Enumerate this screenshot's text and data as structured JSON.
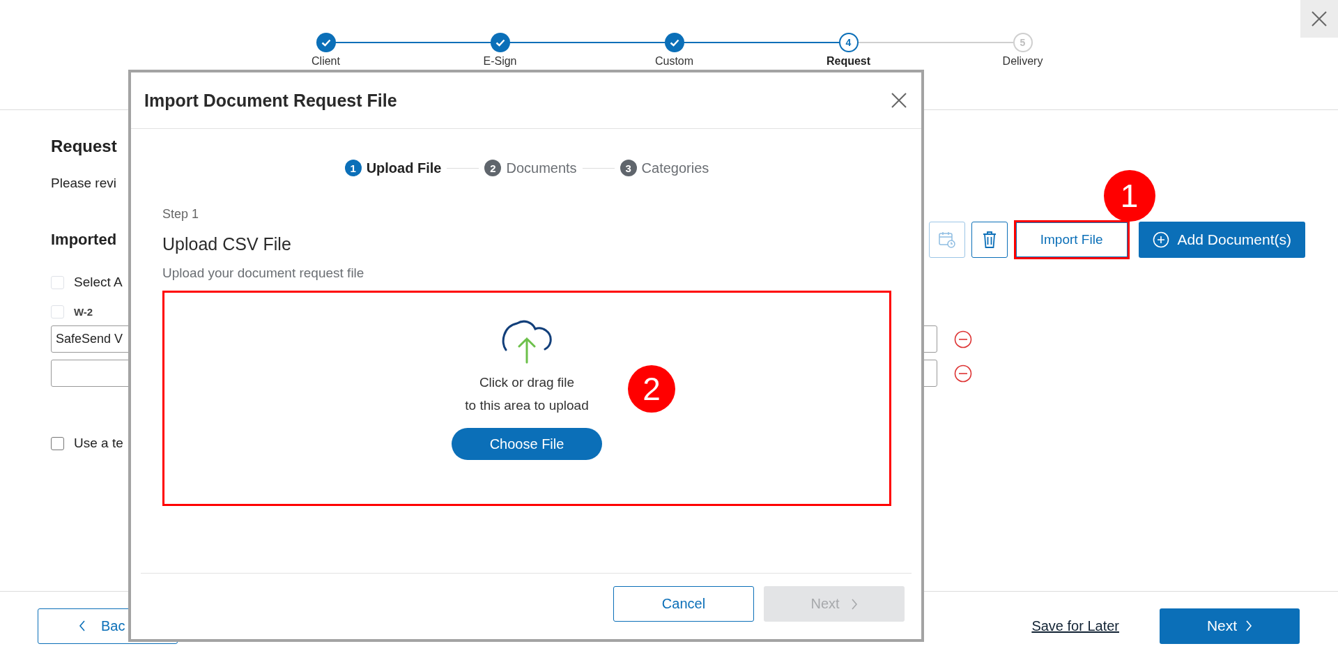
{
  "wizard_steps": [
    {
      "label": "Client",
      "completed": true,
      "current": false
    },
    {
      "label": "E-Sign",
      "completed": true,
      "current": false
    },
    {
      "label": "Custom",
      "completed": true,
      "current": false
    },
    {
      "label": "Request",
      "number": "4",
      "completed": false,
      "current": true
    },
    {
      "label": "Delivery",
      "number": "5",
      "completed": false,
      "current": false
    }
  ],
  "page": {
    "title": "Request",
    "description": "Please revi",
    "section_title": "Imported",
    "select_all": {
      "label": "Select A",
      "checked": false
    },
    "documents": [
      {
        "label": "W-2",
        "checked": false
      }
    ],
    "request_rows": [
      {
        "value": "SafeSend V"
      },
      {}
    ],
    "template_option": {
      "label": "Use a te",
      "checked": false
    }
  },
  "toolbar": {
    "icon_buttons": [
      {
        "kind": "calendar",
        "disabled": true
      },
      {
        "kind": "trash",
        "disabled": false
      }
    ],
    "import_button": "Import File",
    "import_callout": "1",
    "add_button": "Add Document(s)"
  },
  "footer": {
    "back_button": "Bac",
    "save_link": "Save for Later",
    "next_button": "Next"
  },
  "modal": {
    "title": "Import Document Request File",
    "steps": [
      {
        "number": "1",
        "label": "Upload File",
        "selected": true
      },
      {
        "number": "2",
        "label": "Documents",
        "selected": false
      },
      {
        "number": "3",
        "label": "Categories",
        "selected": false
      }
    ],
    "step_caption": "Step 1",
    "heading": "Upload CSV File",
    "subtitle": "Upload your document request file",
    "dropzone": {
      "prompt": "Click or drag file\nto this area to upload",
      "choose_button": "Choose File",
      "callout": "2"
    },
    "cancel_button": "Cancel",
    "next_button": {
      "label": "Next",
      "disabled": true
    }
  }
}
